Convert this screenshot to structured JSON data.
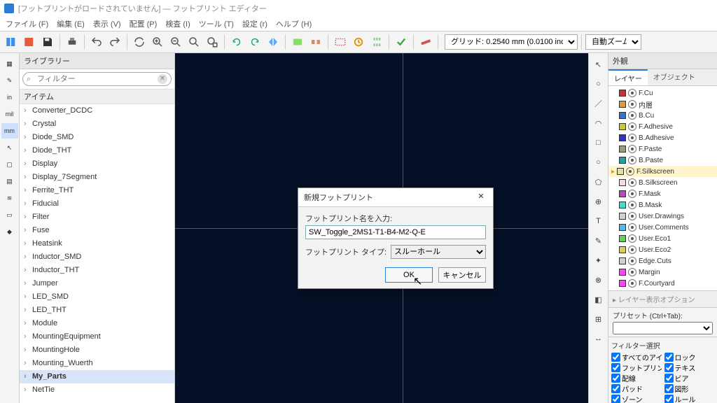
{
  "titlebar": "[フットプリントがロードされていません] — フットプリント エディター",
  "menus": [
    "ファイル (F)",
    "編集 (E)",
    "表示 (V)",
    "配置 (P)",
    "検査 (I)",
    "ツール (T)",
    "設定 (r)",
    "ヘルプ (H)"
  ],
  "grid_options": [
    "グリッド: 0.2540 mm (0.0100 inch)"
  ],
  "grid_selected": "グリッド: 0.2540 mm (0.0100 inch)",
  "zoom_options": [
    "自動ズーム"
  ],
  "zoom_selected": "自動ズーム",
  "library": {
    "title": "ライブラリー",
    "filter_placeholder": "フィルター",
    "item_header": "アイテム",
    "items": [
      "Converter_DCDC",
      "Crystal",
      "Diode_SMD",
      "Diode_THT",
      "Display",
      "Display_7Segment",
      "Ferrite_THT",
      "Fiducial",
      "Filter",
      "Fuse",
      "Heatsink",
      "Inductor_SMD",
      "Inductor_THT",
      "Jumper",
      "LED_SMD",
      "LED_THT",
      "Module",
      "MountingEquipment",
      "MountingHole",
      "Mounting_Wuerth",
      "My_Parts",
      "NetTie"
    ],
    "selected": "My_Parts"
  },
  "left_tools": [
    {
      "label": "▦",
      "name": "grid-icon"
    },
    {
      "label": "✎",
      "name": "sketch-icon"
    },
    {
      "label": "in",
      "name": "unit-in"
    },
    {
      "label": "mil",
      "name": "unit-mil"
    },
    {
      "label": "mm",
      "name": "unit-mm",
      "active": true
    },
    {
      "label": "↖",
      "name": "cursor-full"
    },
    {
      "label": "▢",
      "name": "outline-icon"
    },
    {
      "label": "▤",
      "name": "pad-view"
    },
    {
      "label": "≋",
      "name": "layers-icon"
    },
    {
      "label": "▭",
      "name": "tree-icon"
    },
    {
      "label": "◆",
      "name": "3d-icon"
    }
  ],
  "right_tools": [
    {
      "label": "↖",
      "name": "select-tool"
    },
    {
      "label": "○",
      "name": "pad-tool"
    },
    {
      "label": "／",
      "name": "line-tool"
    },
    {
      "label": "◠",
      "name": "arc-tool"
    },
    {
      "label": "□",
      "name": "rect-tool"
    },
    {
      "label": "○",
      "name": "circle-tool"
    },
    {
      "label": "⬠",
      "name": "poly-tool"
    },
    {
      "label": "⊕",
      "name": "keepout-tool"
    },
    {
      "label": "T",
      "name": "text-tool"
    },
    {
      "label": "✎",
      "name": "dimension-tool"
    },
    {
      "label": "✦",
      "name": "anchor-tool"
    },
    {
      "label": "⊗",
      "name": "delete-tool"
    },
    {
      "label": "◧",
      "name": "origin-tool"
    },
    {
      "label": "⊞",
      "name": "grid-origin-tool"
    },
    {
      "label": "↔",
      "name": "measure-tool"
    }
  ],
  "appearance": {
    "title": "外観",
    "tabs": [
      "レイヤー",
      "オブジェクト"
    ],
    "active_tab": "レイヤー",
    "layers": [
      {
        "name": "F.Cu",
        "color": "#c83232"
      },
      {
        "name": "内層",
        "color": "#d69a4a"
      },
      {
        "name": "B.Cu",
        "color": "#3a6ecf"
      },
      {
        "name": "F.Adhesive",
        "color": "#c8c832"
      },
      {
        "name": "B.Adhesive",
        "color": "#3232c8"
      },
      {
        "name": "F.Paste",
        "color": "#9a9a7d"
      },
      {
        "name": "B.Paste",
        "color": "#20a0a0"
      },
      {
        "name": "F.Silkscreen",
        "color": "#e0e0a0",
        "sel": true
      },
      {
        "name": "B.Silkscreen",
        "color": "#f5d8e8"
      },
      {
        "name": "F.Mask",
        "color": "#b04fb0"
      },
      {
        "name": "B.Mask",
        "color": "#40e0d0"
      },
      {
        "name": "User.Drawings",
        "color": "#d0d0d0"
      },
      {
        "name": "User.Comments",
        "color": "#50b8f0"
      },
      {
        "name": "User.Eco1",
        "color": "#60d060"
      },
      {
        "name": "User.Eco2",
        "color": "#d8d050"
      },
      {
        "name": "Edge.Cuts",
        "color": "#d0d0d0"
      },
      {
        "name": "Margin",
        "color": "#ff40ff"
      },
      {
        "name": "F.Courtyard",
        "color": "#ff40ff"
      }
    ],
    "layer_options": "▸ レイヤー表示オプション",
    "preset_label": "プリセット (Ctrl+Tab):",
    "filter_title": "フィルター選択",
    "filters_l": [
      "すべてのアイテム",
      "フットプリント",
      "配線",
      "パッド",
      "ゾーン"
    ],
    "filters_r": [
      "ロック",
      "テキス",
      "ビア",
      "図形",
      "ルール"
    ]
  },
  "dialog": {
    "title": "新規フットプリント",
    "name_label": "フットプリント名を入力:",
    "name_value": "SW_Toggle_2MS1-T1-B4-M2-Q-E",
    "type_label": "フットプリント タイプ:",
    "type_value": "スルーホール",
    "type_options": [
      "スルーホール"
    ],
    "ok": "OK",
    "cancel": "キャンセル"
  }
}
